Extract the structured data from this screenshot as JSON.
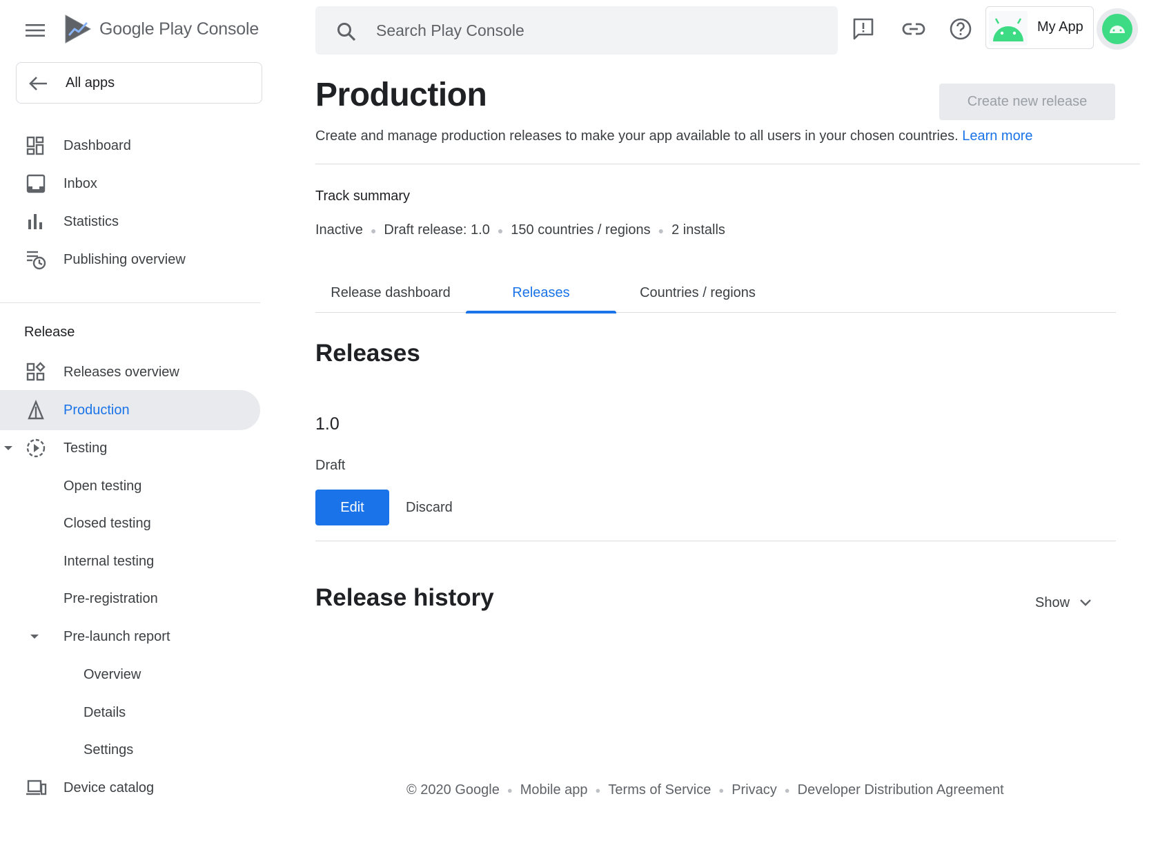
{
  "brand": {
    "logo_text": "Google Play Console"
  },
  "sidebar": {
    "all_apps": "All apps",
    "top_items": [
      {
        "label": "Dashboard",
        "icon": "dashboard-icon"
      },
      {
        "label": "Inbox",
        "icon": "inbox-icon"
      },
      {
        "label": "Statistics",
        "icon": "statistics-icon"
      },
      {
        "label": "Publishing overview",
        "icon": "publishing-overview-icon"
      }
    ],
    "section_title": "Release",
    "release_items": [
      {
        "label": "Releases overview",
        "icon": "releases-overview-icon"
      },
      {
        "label": "Production",
        "icon": "production-icon",
        "active": true
      },
      {
        "label": "Testing",
        "icon": "testing-icon",
        "expanded": true
      }
    ],
    "testing_children": [
      "Open testing",
      "Closed testing",
      "Internal testing",
      "Pre-registration"
    ],
    "prelaunch": {
      "label": "Pre-launch report",
      "expanded": true,
      "children": [
        "Overview",
        "Details",
        "Settings"
      ]
    },
    "device_catalog": {
      "label": "Device catalog",
      "icon": "device-catalog-icon"
    }
  },
  "topbar": {
    "search_placeholder": "Search Play Console",
    "icons": [
      "feedback-icon",
      "link-icon",
      "help-icon"
    ],
    "app_name": "My App"
  },
  "colors": {
    "accent": "#1a73e8",
    "android_green": "#3ddc84"
  },
  "main": {
    "title": "Production",
    "create_button": "Create new release",
    "description": "Create and manage production releases to make your app available to all users in your chosen countries.",
    "learn_more": "Learn more",
    "track_summary_title": "Track summary",
    "track_summary": {
      "status": "Inactive",
      "draft": "Draft release: 1.0",
      "countries": "150 countries / regions",
      "installs": "2 installs"
    },
    "tabs": [
      {
        "label": "Release dashboard"
      },
      {
        "label": "Releases",
        "active": true
      },
      {
        "label": "Countries / regions"
      }
    ],
    "releases_heading": "Releases",
    "release": {
      "version": "1.0",
      "status": "Draft",
      "edit_label": "Edit",
      "discard_label": "Discard"
    },
    "history_heading": "Release history",
    "show_label": "Show"
  },
  "footer": {
    "copyright": "© 2020 Google",
    "links": [
      "Mobile app",
      "Terms of Service",
      "Privacy",
      "Developer Distribution Agreement"
    ]
  }
}
